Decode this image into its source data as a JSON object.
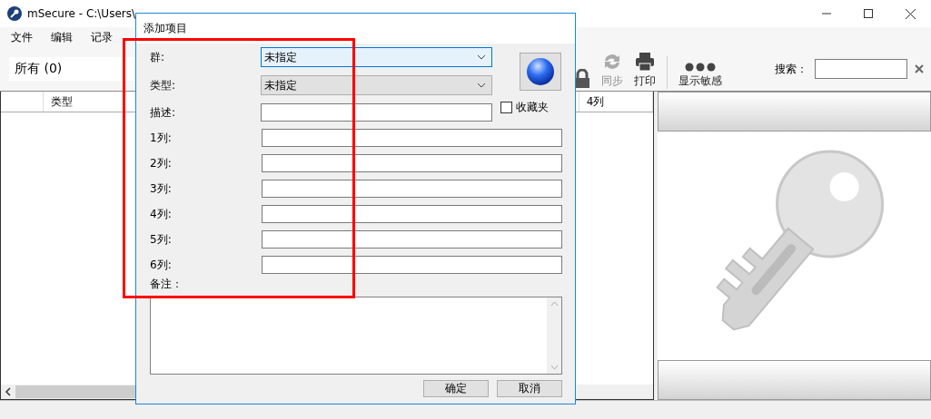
{
  "window": {
    "title": "mSecure - C:\\Users\\"
  },
  "menu": [
    {
      "label": "文件"
    },
    {
      "label": "编辑"
    },
    {
      "label": "记录"
    }
  ],
  "filter": {
    "label": "所有 (0)"
  },
  "toolbar": [
    {
      "kind": "lock"
    },
    {
      "kind": "sync",
      "label": "同步",
      "disabled": true
    },
    {
      "kind": "print",
      "label": "打印",
      "disabled": false
    },
    {
      "kind": "dots",
      "label": "显示敏感",
      "disabled": false
    }
  ],
  "search": {
    "label": "搜索："
  },
  "table": {
    "columns": [
      {
        "label": "类型"
      },
      {
        "label": "4列"
      }
    ]
  },
  "dialog": {
    "title": "添加项目",
    "fields": [
      {
        "kind": "select",
        "label": "群:",
        "value": "未指定",
        "focused": true
      },
      {
        "kind": "select",
        "label": "类型:",
        "value": "未指定",
        "focused": false
      },
      {
        "kind": "text",
        "label": "描述:"
      }
    ],
    "favorite": {
      "label": "收藏夹",
      "checked": false
    },
    "columns": [
      {
        "label": "1列:"
      },
      {
        "label": "2列:"
      },
      {
        "label": "3列:"
      },
      {
        "label": "4列:"
      },
      {
        "label": "5列:"
      },
      {
        "label": "6列:"
      }
    ],
    "notes": {
      "label": "备注："
    },
    "buttons": [
      {
        "label": "确定"
      },
      {
        "label": "取消"
      }
    ]
  }
}
